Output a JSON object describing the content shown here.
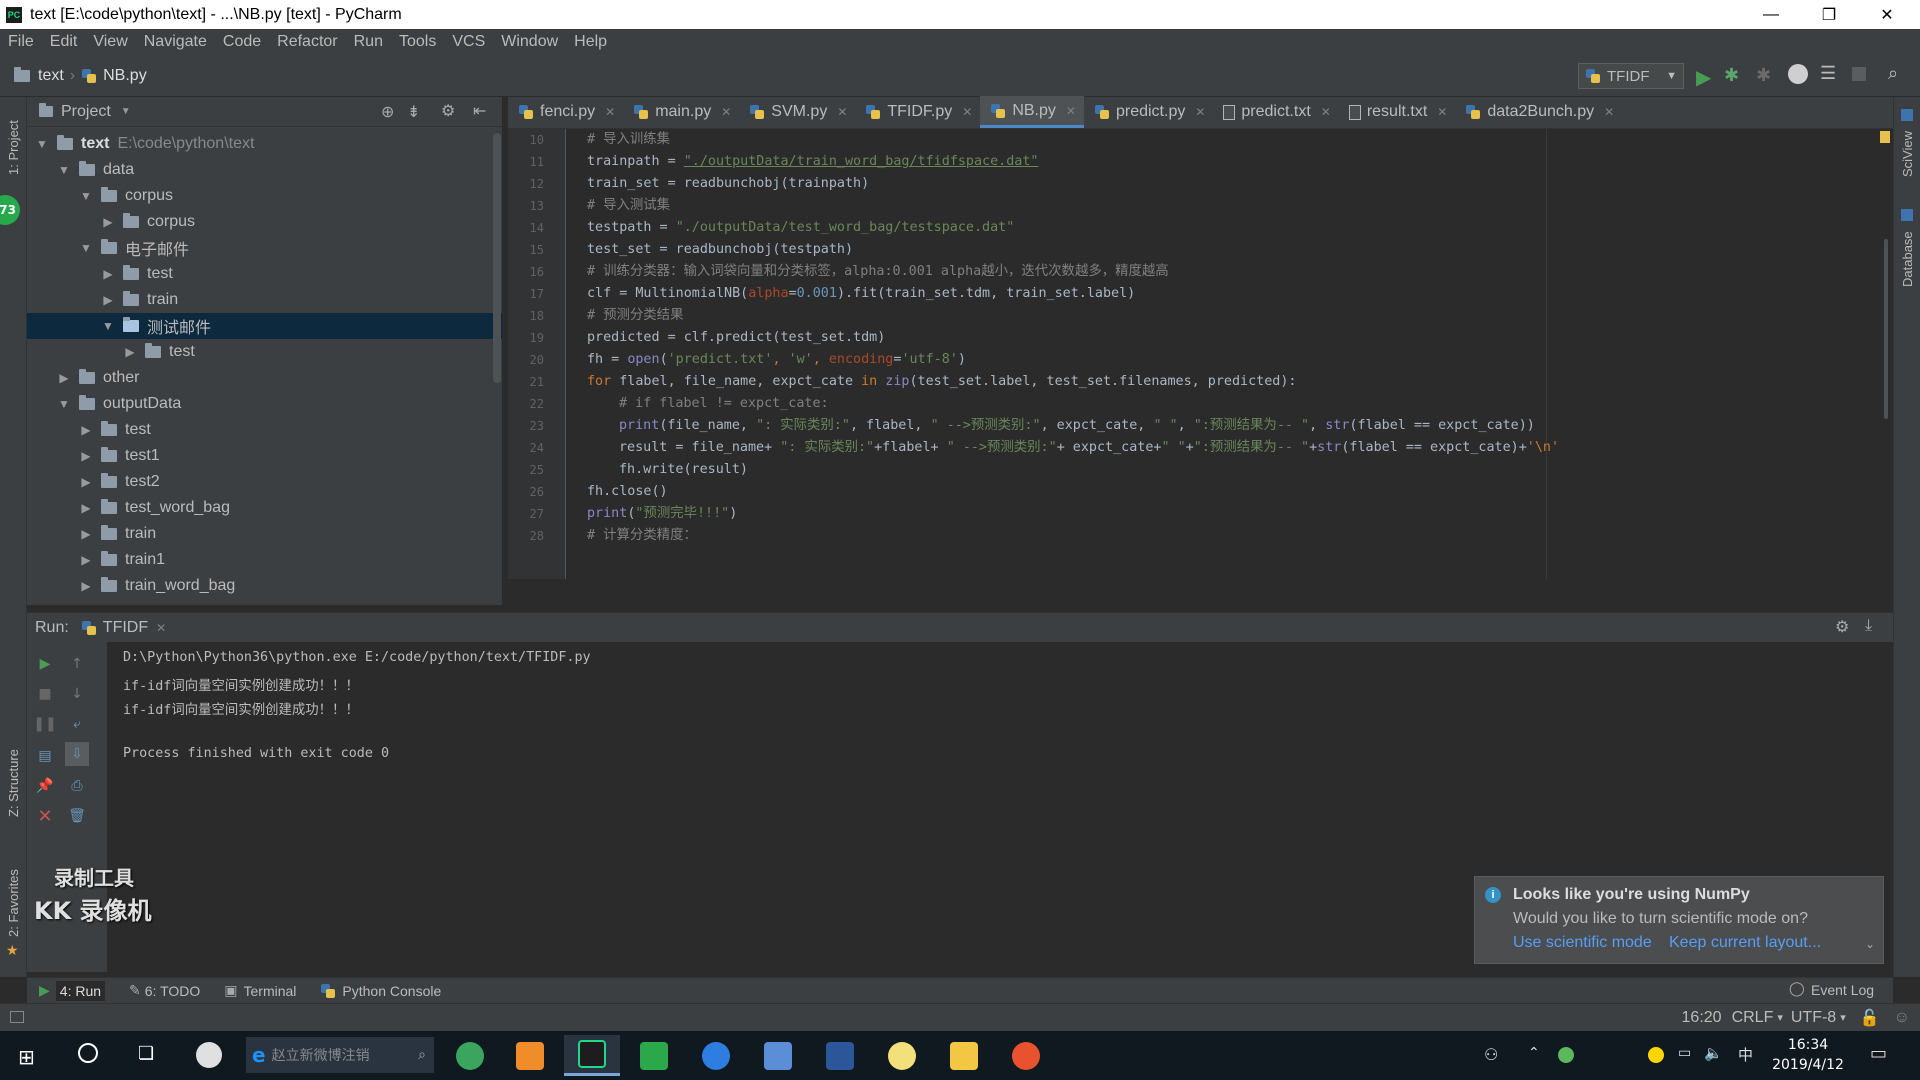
{
  "window": {
    "title": "text [E:\\code\\python\\text] - ...\\NB.py [text] - PyCharm",
    "minimize": "—",
    "restore": "❐",
    "close": "✕"
  },
  "menu": [
    "File",
    "Edit",
    "View",
    "Navigate",
    "Code",
    "Refactor",
    "Run",
    "Tools",
    "VCS",
    "Window",
    "Help"
  ],
  "navbar": {
    "project": "text",
    "file": "NB.py",
    "run_config": "TFIDF"
  },
  "left_stripe": {
    "project_label": "1: Project",
    "structure_label": "Z: Structure",
    "favorites_label": "2: Favorites",
    "badge": "73"
  },
  "right_stripe": {
    "sciview_label": "SciView",
    "database_label": "Database"
  },
  "project_panel": {
    "header": "Project",
    "tree": [
      {
        "label": "text",
        "extra": "E:\\code\\python\\text",
        "depth": 0,
        "arrow": "open"
      },
      {
        "label": "data",
        "depth": 1,
        "arrow": "open"
      },
      {
        "label": "corpus",
        "depth": 2,
        "arrow": "open"
      },
      {
        "label": "corpus",
        "depth": 3,
        "arrow": "closed"
      },
      {
        "label": "电子邮件",
        "depth": 2,
        "arrow": "open"
      },
      {
        "label": "test",
        "depth": 3,
        "arrow": "closed"
      },
      {
        "label": "train",
        "depth": 3,
        "arrow": "closed"
      },
      {
        "label": "测试邮件",
        "depth": 3,
        "arrow": "open",
        "selected": true
      },
      {
        "label": "test",
        "depth": 4,
        "arrow": "closed"
      },
      {
        "label": "other",
        "depth": 1,
        "arrow": "closed"
      },
      {
        "label": "outputData",
        "depth": 1,
        "arrow": "open"
      },
      {
        "label": "test",
        "depth": 2,
        "arrow": "closed"
      },
      {
        "label": "test1",
        "depth": 2,
        "arrow": "closed"
      },
      {
        "label": "test2",
        "depth": 2,
        "arrow": "closed"
      },
      {
        "label": "test_word_bag",
        "depth": 2,
        "arrow": "closed"
      },
      {
        "label": "train",
        "depth": 2,
        "arrow": "closed"
      },
      {
        "label": "train1",
        "depth": 2,
        "arrow": "closed"
      },
      {
        "label": "train_word_bag",
        "depth": 2,
        "arrow": "closed"
      }
    ]
  },
  "editor": {
    "tabs": [
      {
        "label": "fenci.py",
        "type": "py"
      },
      {
        "label": "main.py",
        "type": "py"
      },
      {
        "label": "SVM.py",
        "type": "py"
      },
      {
        "label": "TFIDF.py",
        "type": "py"
      },
      {
        "label": "NB.py",
        "type": "py",
        "active": true
      },
      {
        "label": "predict.py",
        "type": "py"
      },
      {
        "label": "predict.txt",
        "type": "txt"
      },
      {
        "label": "result.txt",
        "type": "txt"
      },
      {
        "label": "data2Bunch.py",
        "type": "py"
      }
    ],
    "line_numbers": [
      "10",
      "11",
      "12",
      "13",
      "14",
      "15",
      "16",
      "17",
      "18",
      "19",
      "20",
      "21",
      "22",
      "23",
      "24",
      "25",
      "26",
      "27",
      "28"
    ],
    "code": {
      "l10": "# 导入训练集",
      "l11a": "trainpath = ",
      "l11b": "\"./outputData/train_word_bag/tfidfspace.dat\"",
      "l12": "train_set = readbunchobj(trainpath)",
      "l13": "# 导入测试集",
      "l14a": "testpath = ",
      "l14b": "\"./outputData/test_word_bag/testspace.dat\"",
      "l15": "test_set = readbunchobj(testpath)",
      "l16": "# 训练分类器：输入词袋向量和分类标签，alpha:0.001 alpha越小，迭代次数越多，精度越高",
      "l17a": "clf = MultinomialNB(",
      "l17b": "alpha",
      "l17c": "=",
      "l17d": "0.001",
      "l17e": ").fit(train_set.tdm, train_set.label)",
      "l18": "# 预测分类结果",
      "l19": "predicted = clf.predict(test_set.tdm)",
      "l20a": "fh = ",
      "l20b": "open",
      "l20c": "(",
      "l20d": "'predict.txt'",
      "l20e": ", ",
      "l20f": "'w'",
      "l20g": ", ",
      "l20h": "encoding",
      "l20i": "=",
      "l20j": "'utf-8'",
      "l20k": ")",
      "l21a": "for ",
      "l21b": "flabel, file_name, expct_cate ",
      "l21c": "in ",
      "l21d": "zip",
      "l21e": "(test_set.label, test_set.filenames, predicted):",
      "l22": "# if flabel != expct_cate:",
      "l23a": "print",
      "l23b": "(file_name, ",
      "l23c": "\": 实际类别:\"",
      "l23d": ", flabel, ",
      "l23e": "\" -->预测类别:\"",
      "l23f": ", expct_cate, ",
      "l23g": "\" \"",
      "l23h": ", ",
      "l23i": "\":预测结果为-- \"",
      "l23j": ", ",
      "l23k": "str",
      "l23l": "(flabel == expct_cate))",
      "l24a": "result = file_name+ ",
      "l24b": "\": 实际类别:\"",
      "l24c": "+flabel+ ",
      "l24d": "\" -->预测类别:\"",
      "l24e": "+ expct_cate+",
      "l24f": "\" \"",
      "l24g": "+",
      "l24h": "\":预测结果为-- \"",
      "l24i": "+",
      "l24j": "str",
      "l24k": "(flabel == expct_cate)+",
      "l24l": "'\\n'",
      "l25": "fh.write(result)",
      "l26": "fh.close()",
      "l27a": "print",
      "l27b": "(",
      "l27c": "\"预测完毕!!!\"",
      "l27d": ")",
      "l28": "# 计算分类精度："
    }
  },
  "run_panel": {
    "label": "Run:",
    "tab": "TFIDF",
    "output": [
      "D:\\Python\\Python36\\python.exe E:/code/python/text/TFIDF.py",
      "if-idf词向量空间实例创建成功！！！",
      "if-idf词向量空间实例创建成功！！！",
      "",
      "Process finished with exit code 0"
    ]
  },
  "watermark": {
    "line1": "录制工具",
    "line2": "KK 录像机"
  },
  "notification": {
    "title": "Looks like you're using NumPy",
    "body": "Would you like to turn scientific mode on?",
    "action1": "Use scientific mode",
    "action2": "Keep current layout..."
  },
  "bottom_tools": {
    "run": "4: Run",
    "todo": "6: TODO",
    "terminal": "Terminal",
    "python_console": "Python Console",
    "event_log": "Event Log"
  },
  "status": {
    "position": "16:20",
    "line_sep": "CRLF",
    "encoding": "UTF-8"
  },
  "taskbar": {
    "search_placeholder": "赵立新微博注销",
    "time": "16:34",
    "date": "2019/4/12",
    "ime": "中"
  },
  "colors": {
    "accent": "#4a88c7",
    "selection": "#0d293e",
    "run_green": "#499c54",
    "link": "#589df6"
  }
}
